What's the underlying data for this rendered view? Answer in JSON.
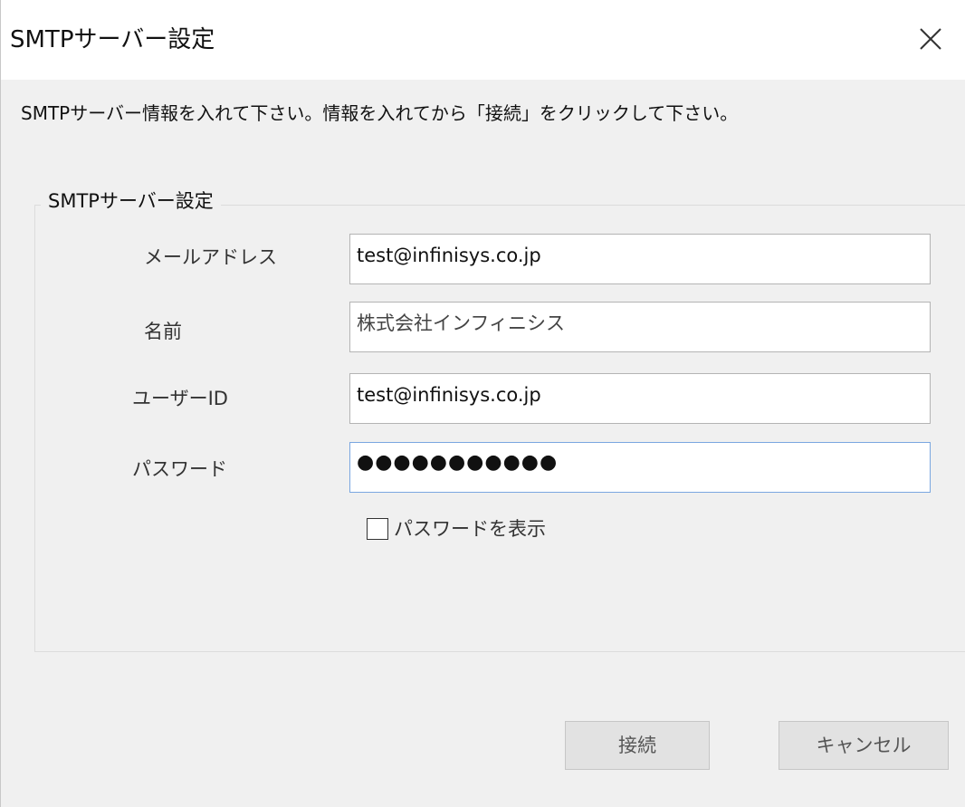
{
  "window": {
    "title": "SMTPサーバー設定",
    "close_icon": "close-icon"
  },
  "instruction": "SMTPサーバー情報を入れて下さい。情報を入れてから「接続」をクリックして下さい。",
  "group": {
    "legend": "SMTPサーバー設定",
    "fields": {
      "email": {
        "label": "メールアドレス",
        "value": "test@infinisys.co.jp"
      },
      "name": {
        "label": "名前",
        "value": "株式会社インフィニシス"
      },
      "user_id": {
        "label": "ユーザーID",
        "value": "test@infinisys.co.jp"
      },
      "password": {
        "label": "パスワード",
        "value": "●●●●●●●●●●●"
      }
    },
    "show_password": {
      "label": "パスワードを表示",
      "checked": false
    }
  },
  "buttons": {
    "connect": "接続",
    "cancel": "キャンセル"
  }
}
